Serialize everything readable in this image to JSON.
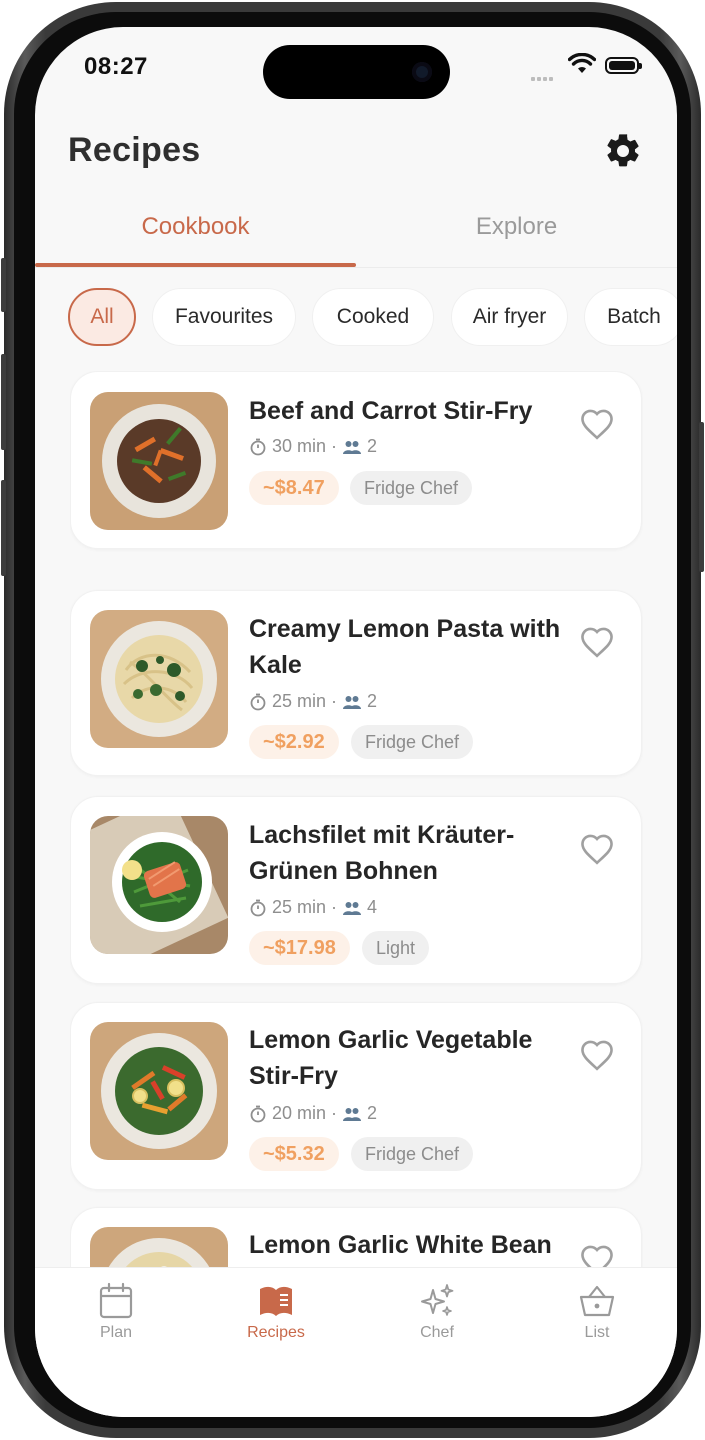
{
  "status_bar": {
    "time": "08:27"
  },
  "header": {
    "title": "Recipes",
    "settings_icon": "gear-icon"
  },
  "tabs": [
    {
      "label": "Cookbook",
      "active": true
    },
    {
      "label": "Explore",
      "active": false
    }
  ],
  "filters": [
    {
      "label": "All",
      "active": true
    },
    {
      "label": "Favourites",
      "active": false
    },
    {
      "label": "Cooked",
      "active": false
    },
    {
      "label": "Air fryer",
      "active": false
    },
    {
      "label": "Batch",
      "active": false
    }
  ],
  "recipes": [
    {
      "title": "Beef and Carrot Stir-Fry",
      "time": "30 min",
      "servings": "2",
      "price": "~$8.47",
      "tag": "Fridge Chef"
    },
    {
      "title": "Creamy Lemon Pasta with Kale",
      "time": "25 min",
      "servings": "2",
      "price": "~$2.92",
      "tag": "Fridge Chef"
    },
    {
      "title": "Lachsfilet mit Kräuter-Grünen Bohnen",
      "time": "25 min",
      "servings": "4",
      "price": "~$17.98",
      "tag": "Light"
    },
    {
      "title": "Lemon Garlic Vegetable Stir-Fry",
      "time": "20 min",
      "servings": "2",
      "price": "~$5.32",
      "tag": "Fridge Chef"
    },
    {
      "title": "Lemon Garlic White Bean and Kale Pasta",
      "time": "",
      "servings": "",
      "price": "",
      "tag": ""
    }
  ],
  "meta_separator": "·",
  "bottom_nav": [
    {
      "label": "Plan",
      "icon": "calendar-icon",
      "active": false
    },
    {
      "label": "Recipes",
      "icon": "book-icon",
      "active": true
    },
    {
      "label": "Chef",
      "icon": "sparkles-icon",
      "active": false
    },
    {
      "label": "List",
      "icon": "basket-icon",
      "active": false
    }
  ],
  "colors": {
    "accent": "#c8694a",
    "price": "#f0a060",
    "price_bg": "#fdf1e8",
    "background": "#f8f8f8"
  }
}
